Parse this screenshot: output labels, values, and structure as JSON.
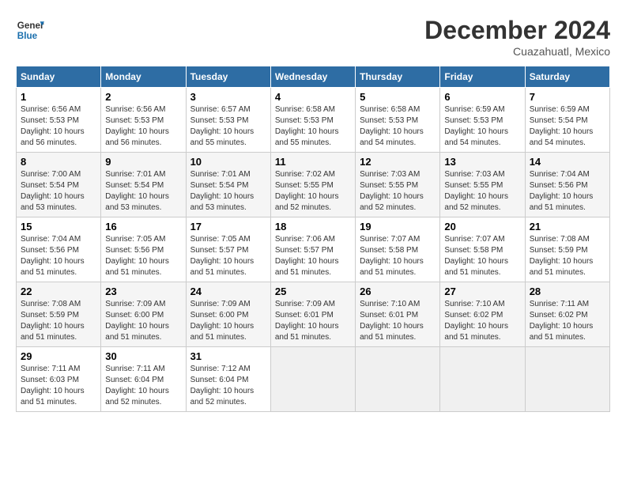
{
  "logo": {
    "line1": "General",
    "line2": "Blue"
  },
  "title": "December 2024",
  "subtitle": "Cuazahuatl, Mexico",
  "weekdays": [
    "Sunday",
    "Monday",
    "Tuesday",
    "Wednesday",
    "Thursday",
    "Friday",
    "Saturday"
  ],
  "weeks": [
    [
      {
        "day": "1",
        "sunrise": "6:56 AM",
        "sunset": "5:53 PM",
        "daylight": "10 hours and 56 minutes."
      },
      {
        "day": "2",
        "sunrise": "6:56 AM",
        "sunset": "5:53 PM",
        "daylight": "10 hours and 56 minutes."
      },
      {
        "day": "3",
        "sunrise": "6:57 AM",
        "sunset": "5:53 PM",
        "daylight": "10 hours and 55 minutes."
      },
      {
        "day": "4",
        "sunrise": "6:58 AM",
        "sunset": "5:53 PM",
        "daylight": "10 hours and 55 minutes."
      },
      {
        "day": "5",
        "sunrise": "6:58 AM",
        "sunset": "5:53 PM",
        "daylight": "10 hours and 54 minutes."
      },
      {
        "day": "6",
        "sunrise": "6:59 AM",
        "sunset": "5:53 PM",
        "daylight": "10 hours and 54 minutes."
      },
      {
        "day": "7",
        "sunrise": "6:59 AM",
        "sunset": "5:54 PM",
        "daylight": "10 hours and 54 minutes."
      }
    ],
    [
      {
        "day": "8",
        "sunrise": "7:00 AM",
        "sunset": "5:54 PM",
        "daylight": "10 hours and 53 minutes."
      },
      {
        "day": "9",
        "sunrise": "7:01 AM",
        "sunset": "5:54 PM",
        "daylight": "10 hours and 53 minutes."
      },
      {
        "day": "10",
        "sunrise": "7:01 AM",
        "sunset": "5:54 PM",
        "daylight": "10 hours and 53 minutes."
      },
      {
        "day": "11",
        "sunrise": "7:02 AM",
        "sunset": "5:55 PM",
        "daylight": "10 hours and 52 minutes."
      },
      {
        "day": "12",
        "sunrise": "7:03 AM",
        "sunset": "5:55 PM",
        "daylight": "10 hours and 52 minutes."
      },
      {
        "day": "13",
        "sunrise": "7:03 AM",
        "sunset": "5:55 PM",
        "daylight": "10 hours and 52 minutes."
      },
      {
        "day": "14",
        "sunrise": "7:04 AM",
        "sunset": "5:56 PM",
        "daylight": "10 hours and 51 minutes."
      }
    ],
    [
      {
        "day": "15",
        "sunrise": "7:04 AM",
        "sunset": "5:56 PM",
        "daylight": "10 hours and 51 minutes."
      },
      {
        "day": "16",
        "sunrise": "7:05 AM",
        "sunset": "5:56 PM",
        "daylight": "10 hours and 51 minutes."
      },
      {
        "day": "17",
        "sunrise": "7:05 AM",
        "sunset": "5:57 PM",
        "daylight": "10 hours and 51 minutes."
      },
      {
        "day": "18",
        "sunrise": "7:06 AM",
        "sunset": "5:57 PM",
        "daylight": "10 hours and 51 minutes."
      },
      {
        "day": "19",
        "sunrise": "7:07 AM",
        "sunset": "5:58 PM",
        "daylight": "10 hours and 51 minutes."
      },
      {
        "day": "20",
        "sunrise": "7:07 AM",
        "sunset": "5:58 PM",
        "daylight": "10 hours and 51 minutes."
      },
      {
        "day": "21",
        "sunrise": "7:08 AM",
        "sunset": "5:59 PM",
        "daylight": "10 hours and 51 minutes."
      }
    ],
    [
      {
        "day": "22",
        "sunrise": "7:08 AM",
        "sunset": "5:59 PM",
        "daylight": "10 hours and 51 minutes."
      },
      {
        "day": "23",
        "sunrise": "7:09 AM",
        "sunset": "6:00 PM",
        "daylight": "10 hours and 51 minutes."
      },
      {
        "day": "24",
        "sunrise": "7:09 AM",
        "sunset": "6:00 PM",
        "daylight": "10 hours and 51 minutes."
      },
      {
        "day": "25",
        "sunrise": "7:09 AM",
        "sunset": "6:01 PM",
        "daylight": "10 hours and 51 minutes."
      },
      {
        "day": "26",
        "sunrise": "7:10 AM",
        "sunset": "6:01 PM",
        "daylight": "10 hours and 51 minutes."
      },
      {
        "day": "27",
        "sunrise": "7:10 AM",
        "sunset": "6:02 PM",
        "daylight": "10 hours and 51 minutes."
      },
      {
        "day": "28",
        "sunrise": "7:11 AM",
        "sunset": "6:02 PM",
        "daylight": "10 hours and 51 minutes."
      }
    ],
    [
      {
        "day": "29",
        "sunrise": "7:11 AM",
        "sunset": "6:03 PM",
        "daylight": "10 hours and 51 minutes."
      },
      {
        "day": "30",
        "sunrise": "7:11 AM",
        "sunset": "6:04 PM",
        "daylight": "10 hours and 52 minutes."
      },
      {
        "day": "31",
        "sunrise": "7:12 AM",
        "sunset": "6:04 PM",
        "daylight": "10 hours and 52 minutes."
      },
      null,
      null,
      null,
      null
    ]
  ]
}
